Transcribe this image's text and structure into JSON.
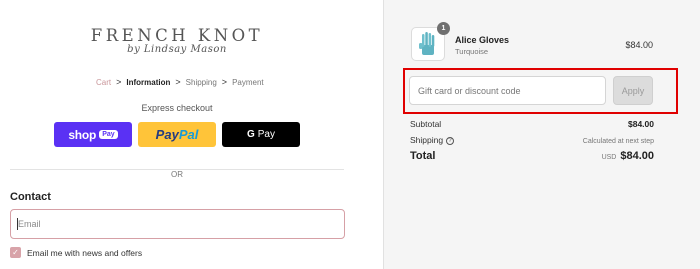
{
  "brand": {
    "title": "FRENCH KNOT",
    "subtitle": "by Lindsay Mason"
  },
  "breadcrumb": {
    "items": [
      {
        "label": "Cart",
        "state": "link"
      },
      {
        "label": "Information",
        "state": "current"
      },
      {
        "label": "Shipping",
        "state": "upcoming"
      },
      {
        "label": "Payment",
        "state": "upcoming"
      }
    ],
    "separator": ">"
  },
  "express": {
    "label": "Express checkout",
    "shop_pay": {
      "word": "shop",
      "pill": "Pay"
    },
    "paypal": {
      "pay": "Pay",
      "pal": "Pal"
    },
    "gpay": {
      "g": "G",
      "pay": "Pay"
    }
  },
  "divider": {
    "label": "OR"
  },
  "contact": {
    "heading": "Contact",
    "email_placeholder": "Email",
    "email_value": "",
    "newsletter_label": "Email me with news and offers",
    "newsletter_checked": true
  },
  "cart": {
    "item": {
      "name": "Alice Gloves",
      "variant": "Turquoise",
      "price": "$84.00",
      "quantity": "1",
      "thumb_color": "#5fb3c2"
    }
  },
  "discount": {
    "placeholder": "Gift card or discount code",
    "value": "",
    "apply_label": "Apply"
  },
  "summary": {
    "subtotal_label": "Subtotal",
    "subtotal_value": "$84.00",
    "shipping_label": "Shipping",
    "shipping_value": "Calculated at next step",
    "total_label": "Total",
    "currency": "USD",
    "total_value": "$84.00"
  },
  "colors": {
    "accent_pink": "#d8a3a9",
    "shop_pay": "#5a31f4",
    "paypal": "#ffc439",
    "highlight": "#e00000"
  }
}
